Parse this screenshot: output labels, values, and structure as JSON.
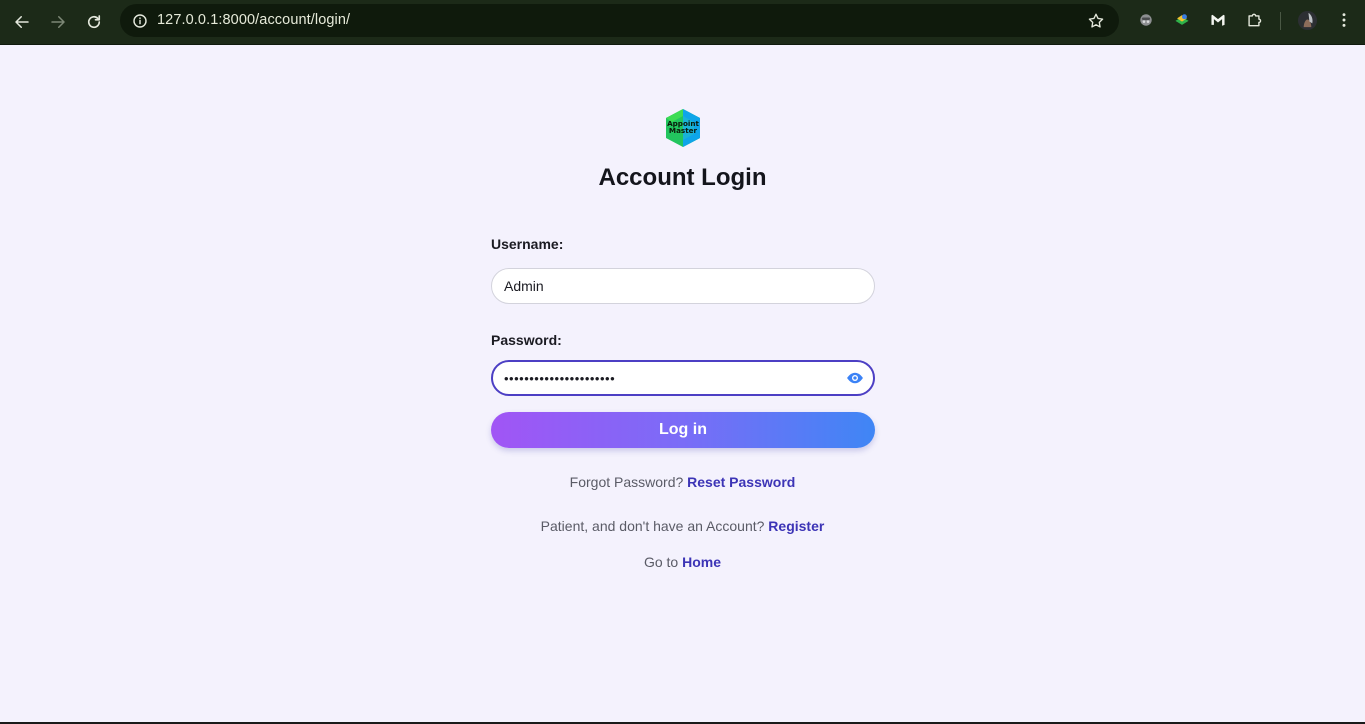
{
  "browser": {
    "url": "127.0.0.1:8000/account/login/",
    "icons": {
      "back": "back-arrow-icon",
      "forward": "forward-arrow-icon",
      "reload": "reload-icon",
      "site_info": "info-icon",
      "bookmark": "star-icon",
      "extensions": [
        "incognito-extension-icon",
        "layers-extension-icon",
        "malwarebytes-extension-icon",
        "puzzle-extensions-icon"
      ],
      "profile": "profile-avatar",
      "menu": "kebab-menu-icon"
    }
  },
  "logo": {
    "line1": "Appoint",
    "line2": "Master",
    "colors": [
      "#22c55e",
      "#0ea5e9"
    ]
  },
  "page": {
    "title": "Account Login"
  },
  "form": {
    "username_label": "Username:",
    "username_value": "Admin",
    "password_label": "Password:",
    "password_value": "••••••••••••••••••••••",
    "password_toggle_icon": "eye-icon",
    "submit_label": "Log in"
  },
  "links": {
    "forgot_prefix": "Forgot Password?",
    "forgot_link": "Reset Password",
    "register_prefix": "Patient, and don't have an Account?",
    "register_link": "Register",
    "home_prefix": "Go to",
    "home_link": "Home"
  },
  "colors": {
    "accent": "#4c3fc4",
    "button_gradient_start": "#a155f5",
    "button_gradient_end": "#3f86f5",
    "link": "#3c34b6",
    "background": "#f4f2fd"
  }
}
